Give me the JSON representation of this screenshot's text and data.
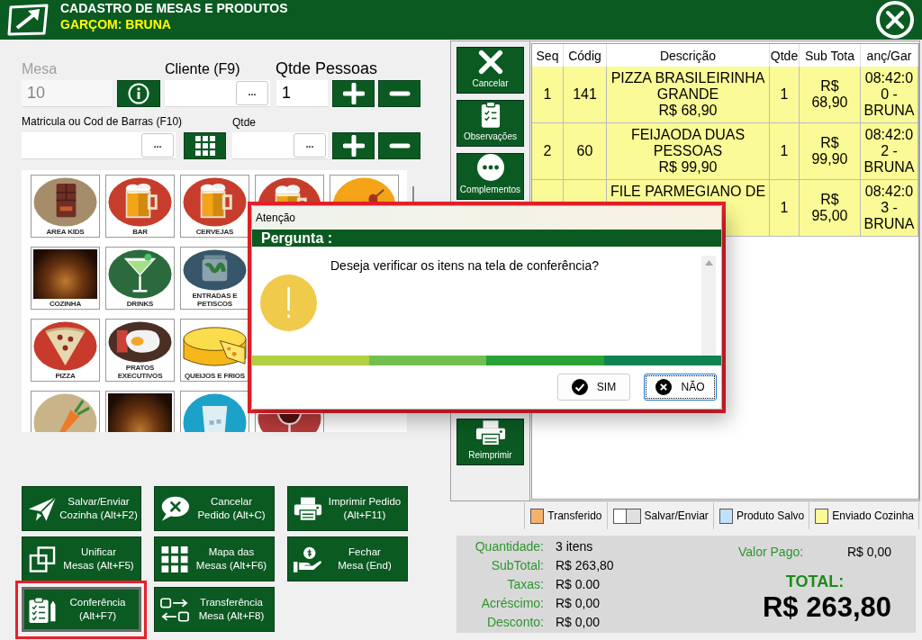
{
  "header": {
    "title": "CADASTRO DE MESAS E PRODUTOS",
    "waiter": "GARÇOM: BRUNA"
  },
  "form": {
    "table_number": {
      "label": "Mesa",
      "value": "10",
      "disabled": true
    },
    "client": {
      "label": "Cliente (F9)",
      "browse_button": "..."
    },
    "people": {
      "label": "Qtde Pessoas",
      "value": "1"
    },
    "barcode": {
      "label": "Matricula ou Cod de Barras (F10)",
      "browse_button": "..."
    },
    "quantity": {
      "label": "Qtde",
      "browse_button": "..."
    }
  },
  "categories": {
    "rows": [
      {
        "tiles": [
          {
            "kind": "icon",
            "label": "AREA KIDS"
          },
          {
            "kind": "icon",
            "label": "BAR"
          },
          {
            "kind": "icon",
            "label": "CERVEJAS"
          },
          {
            "kind": "icon"
          },
          {
            "kind": "icon"
          }
        ]
      },
      {
        "tiles": [
          {
            "kind": "photo",
            "label": "COZINHA"
          },
          {
            "kind": "icon",
            "label": "DRINKS"
          },
          {
            "kind": "icon",
            "label": "ENTRADAS E PETISCOS"
          }
        ]
      },
      {
        "tiles": [
          {
            "kind": "icon",
            "label": "PIZZA"
          },
          {
            "kind": "icon",
            "label": "PRATOS EXECUTIVOS"
          },
          {
            "kind": "icon",
            "label": "QUEIJOS E FRIOS"
          }
        ]
      },
      {
        "tiles": [
          {
            "kind": "icon"
          },
          {
            "kind": "photo"
          },
          {
            "kind": "icon"
          },
          {
            "kind": "icon"
          }
        ]
      }
    ]
  },
  "actions": [
    {
      "label": "Salvar/Enviar\nCozinha (Alt+F2)",
      "focused": false,
      "highlighted": false
    },
    {
      "label": "Cancelar\nPedido (Alt+C)",
      "focused": false,
      "highlighted": false
    },
    {
      "label": "Imprimir Pedido\n(Alt+F11)",
      "focused": false,
      "highlighted": false
    },
    {
      "label": "Unificar\nMesas (Alt+F5)",
      "focused": false,
      "highlighted": false
    },
    {
      "label": "Mapa das\nMesas (Alt+F6)",
      "focused": false,
      "highlighted": false
    },
    {
      "label": "Fechar\nMesa (End)",
      "focused": false,
      "highlighted": false
    },
    {
      "label": "Conferência\n(Alt+F7)",
      "focused": true,
      "highlighted": true
    },
    {
      "label": "Transferência\nMesa (Alt+F8)",
      "focused": false,
      "highlighted": false
    }
  ],
  "toolbar": {
    "top": [
      {
        "label": "Cancelar"
      },
      {
        "label": "Observações"
      },
      {
        "label": "Complementos"
      }
    ],
    "bottom": [
      {
        "label": "Reimprimir"
      }
    ]
  },
  "order_table": {
    "columns": [
      "Seq",
      "Códig",
      "Descrição",
      "Qtde",
      "Sub Tota",
      "anç/Gar"
    ],
    "rows": [
      {
        "sent_to_kitchen": true,
        "seq": "1",
        "code": "141",
        "description": "PIZZA BRASILEIRINHA GRANDE\nR$ 68,90",
        "qty": "1",
        "subtotal": "R$ 68,90",
        "entry": "08:42:00 - BRUNA"
      },
      {
        "sent_to_kitchen": true,
        "seq": "2",
        "code": "60",
        "description": "FEIJAODA DUAS PESSOAS\nR$ 99,90",
        "qty": "1",
        "subtotal": "R$ 99,90",
        "entry": "08:42:02 - BRUNA"
      },
      {
        "sent_to_kitchen": true,
        "description": "FILE PARMEGIANO DE",
        "qty": "1",
        "subtotal": "R$ 95,00",
        "entry": "08:42:03 - BRUNA"
      }
    ]
  },
  "legend": [
    {
      "label": "Transferido",
      "swatches": [
        {
          "color": "#f4b26c"
        }
      ]
    },
    {
      "label": "Salvar/Enviar",
      "swatches": [
        {
          "color": "#ffffff"
        },
        {
          "color": "#e0e0e0"
        }
      ]
    },
    {
      "label": "Produto Salvo",
      "swatches": [
        {
          "color": "#bfe1fa"
        }
      ]
    },
    {
      "label": "Enviado Cozinha",
      "swatches": [
        {
          "color": "#fafa96"
        }
      ]
    }
  ],
  "totals": {
    "lines": [
      {
        "label": "Quantidade:",
        "value": "3 itens"
      },
      {
        "label": "SubTotal:",
        "value": "R$ 263,80"
      },
      {
        "label": "Taxas:",
        "value": "R$ 0.00"
      },
      {
        "label": "Acréscimo:",
        "value": "R$ 0,00"
      },
      {
        "label": "Desconto:",
        "value": "R$ 0,00"
      }
    ],
    "paid": {
      "label": "Valor Pago:",
      "value": "R$ 0,00"
    },
    "total": {
      "label": "TOTAL:",
      "value": "R$ 263,80"
    }
  },
  "dialog": {
    "title": "Atenção",
    "heading": "Pergunta :",
    "message": "Deseja verificar os itens na tela de conferência?",
    "highlighted": true,
    "buttons": [
      {
        "kind": "confirm",
        "label": "SIM",
        "focused": false
      },
      {
        "kind": "cancel",
        "label": "NÃO",
        "focused": true
      }
    ]
  }
}
